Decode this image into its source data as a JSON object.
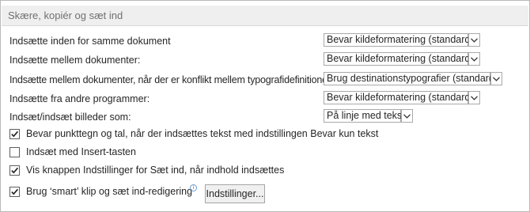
{
  "section": {
    "title": "Skære, kopiér og sæt ind"
  },
  "rows": [
    {
      "label": "Indsætte inden for samme dokument",
      "value": "Bevar kildeformatering (standard)"
    },
    {
      "label": "Indsætte mellem dokumenter:",
      "value": "Bevar kildeformatering (standard)"
    },
    {
      "label": "Indsætte mellem dokumenter, når der er konflikt mellem typografidefinitioner:",
      "value": "Brug destinationstypografier (standard)"
    },
    {
      "label": "Indsætte fra andre programmer:",
      "value": "Bevar kildeformatering (standard)"
    },
    {
      "label": "Indsæt/indsæt billeder som:",
      "value": "På linje med tekst"
    }
  ],
  "checkboxes": [
    {
      "label": "Bevar punkttegn og tal, når der indsættes tekst med indstillingen Bevar kun tekst",
      "checked": true
    },
    {
      "label": "Indsæt med Insert-tasten",
      "checked": false
    },
    {
      "label": "Vis knappen Indstillinger for Sæt ind, når indhold indsættes",
      "checked": true
    },
    {
      "label": "Brug ‘smart’ klip og sæt ind-redigering",
      "checked": true
    }
  ],
  "info_icon": {
    "glyph": "i",
    "icon": "info-icon"
  },
  "settings_button": {
    "label": "Indstillinger..."
  },
  "colors": {
    "header_bg": "#efefef",
    "header_text": "#707070",
    "text": "#262626",
    "border": "#a9a9a9",
    "info_blue": "#2e75b6"
  }
}
